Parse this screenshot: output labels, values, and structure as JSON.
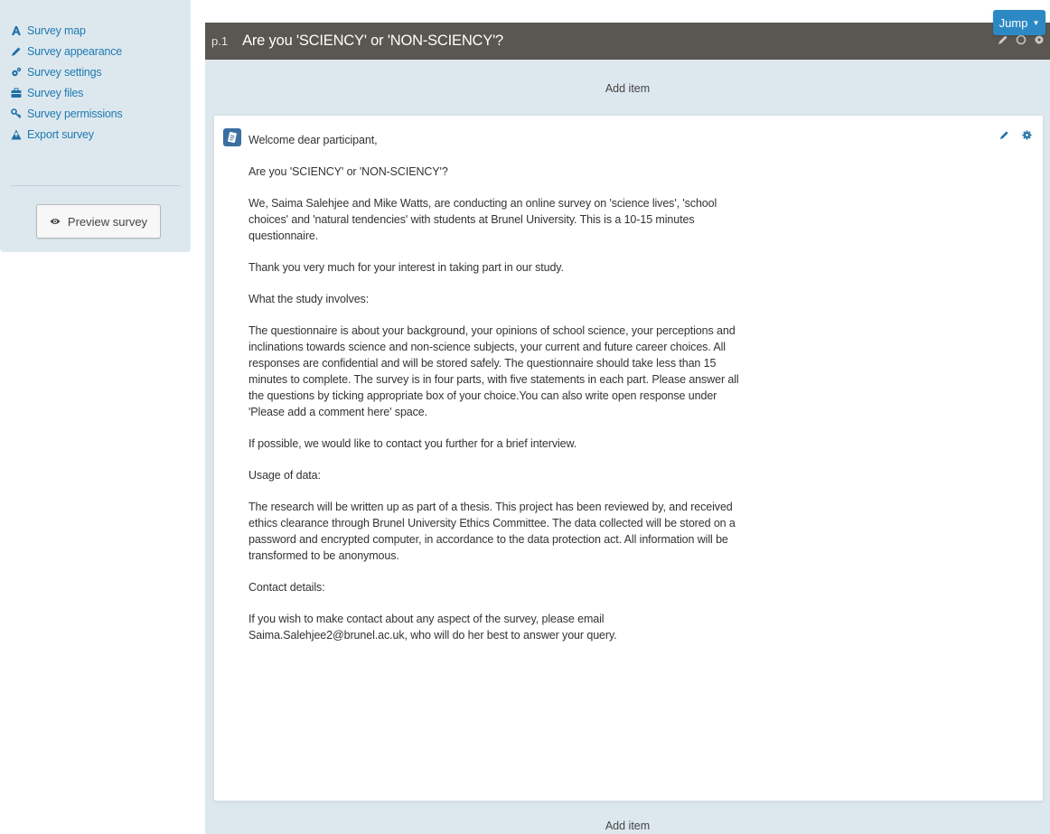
{
  "sidebar": {
    "items": [
      {
        "label": "Survey map",
        "icon": "survey-map-icon"
      },
      {
        "label": "Survey appearance",
        "icon": "pencil-icon"
      },
      {
        "label": "Survey settings",
        "icon": "gears-icon"
      },
      {
        "label": "Survey files",
        "icon": "briefcase-icon"
      },
      {
        "label": "Survey permissions",
        "icon": "key-icon"
      },
      {
        "label": "Export survey",
        "icon": "export-icon"
      }
    ],
    "preview_label": "Preview survey"
  },
  "page": {
    "number": "p.1",
    "title": "Are you 'SCIENCY' or 'NON-SCIENCY'?",
    "add_item_label": "Add item",
    "jump_label": "Jump"
  },
  "item": {
    "paragraphs": [
      "Welcome dear participant,",
      "Are you 'SCIENCY' or 'NON-SCIENCY'?",
      "We, Saima Salehjee and Mike Watts, are conducting an online survey on 'science lives', 'school choices' and 'natural tendencies' with students at Brunel University. This is a 10-15 minutes questionnaire.",
      "Thank you very much for your interest in taking part in our study.",
      "What the study involves:",
      "The questionnaire is about your background, your opinions of school science, your perceptions and inclinations towards science and non-science subjects, your current and future career choices. All responses are confidential and will be stored safely. The questionnaire should take less than 15 minutes to complete. The survey is in four parts, with five statements in each part. Please answer all the questions by ticking appropriate box of your choice.You can also write open response under 'Please add a comment here' space.",
      "If possible, we would like to contact you further for a brief interview.",
      "Usage of data:",
      "The research will be written up as part of a thesis. This project has been reviewed by, and received ethics clearance through Brunel University Ethics Committee. The data collected will be stored on a password and encrypted computer, in accordance to the data protection act. All information will be transformed to be anonymous.",
      "Contact details:",
      "If you wish to make contact about any aspect of the survey, please email Saima.Salehjee2@brunel.ac.uk, who will do her best to answer your query."
    ]
  },
  "colors": {
    "sidebar_bg": "#dde8ee",
    "link": "#1f7ab3",
    "header_bg": "#5a5651",
    "jump_bg": "#2d89c4"
  }
}
